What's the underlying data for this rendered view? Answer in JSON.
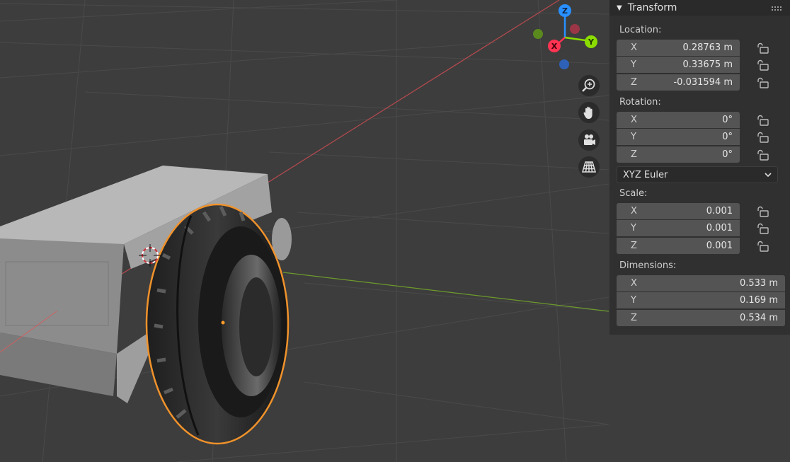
{
  "gizmo": {
    "axis_z": "Z",
    "axis_y": "Y",
    "axis_x": "X"
  },
  "nav_tools": [
    {
      "name": "zoom-icon"
    },
    {
      "name": "hand-pan-icon"
    },
    {
      "name": "camera-icon"
    },
    {
      "name": "grid-perspective-icon"
    }
  ],
  "panel": {
    "title": "Transform",
    "location": {
      "label": "Location:",
      "rows": [
        {
          "axis": "X",
          "value": "0.28763 m"
        },
        {
          "axis": "Y",
          "value": "0.33675 m"
        },
        {
          "axis": "Z",
          "value": "-0.031594 m"
        }
      ]
    },
    "rotation": {
      "label": "Rotation:",
      "rows": [
        {
          "axis": "X",
          "value": "0°"
        },
        {
          "axis": "Y",
          "value": "0°"
        },
        {
          "axis": "Z",
          "value": "0°"
        }
      ],
      "mode": "XYZ Euler"
    },
    "scale": {
      "label": "Scale:",
      "rows": [
        {
          "axis": "X",
          "value": "0.001"
        },
        {
          "axis": "Y",
          "value": "0.001"
        },
        {
          "axis": "Z",
          "value": "0.001"
        }
      ]
    },
    "dimensions": {
      "label": "Dimensions:",
      "rows": [
        {
          "axis": "X",
          "value": "0.533 m"
        },
        {
          "axis": "Y",
          "value": "0.169 m"
        },
        {
          "axis": "Z",
          "value": "0.534 m"
        }
      ]
    }
  },
  "colors": {
    "background": "#3d3d3d",
    "selection_outline": "#f0922b",
    "axis_x": "#ff3352",
    "axis_y": "#8bdc00",
    "axis_z": "#2890ff"
  }
}
